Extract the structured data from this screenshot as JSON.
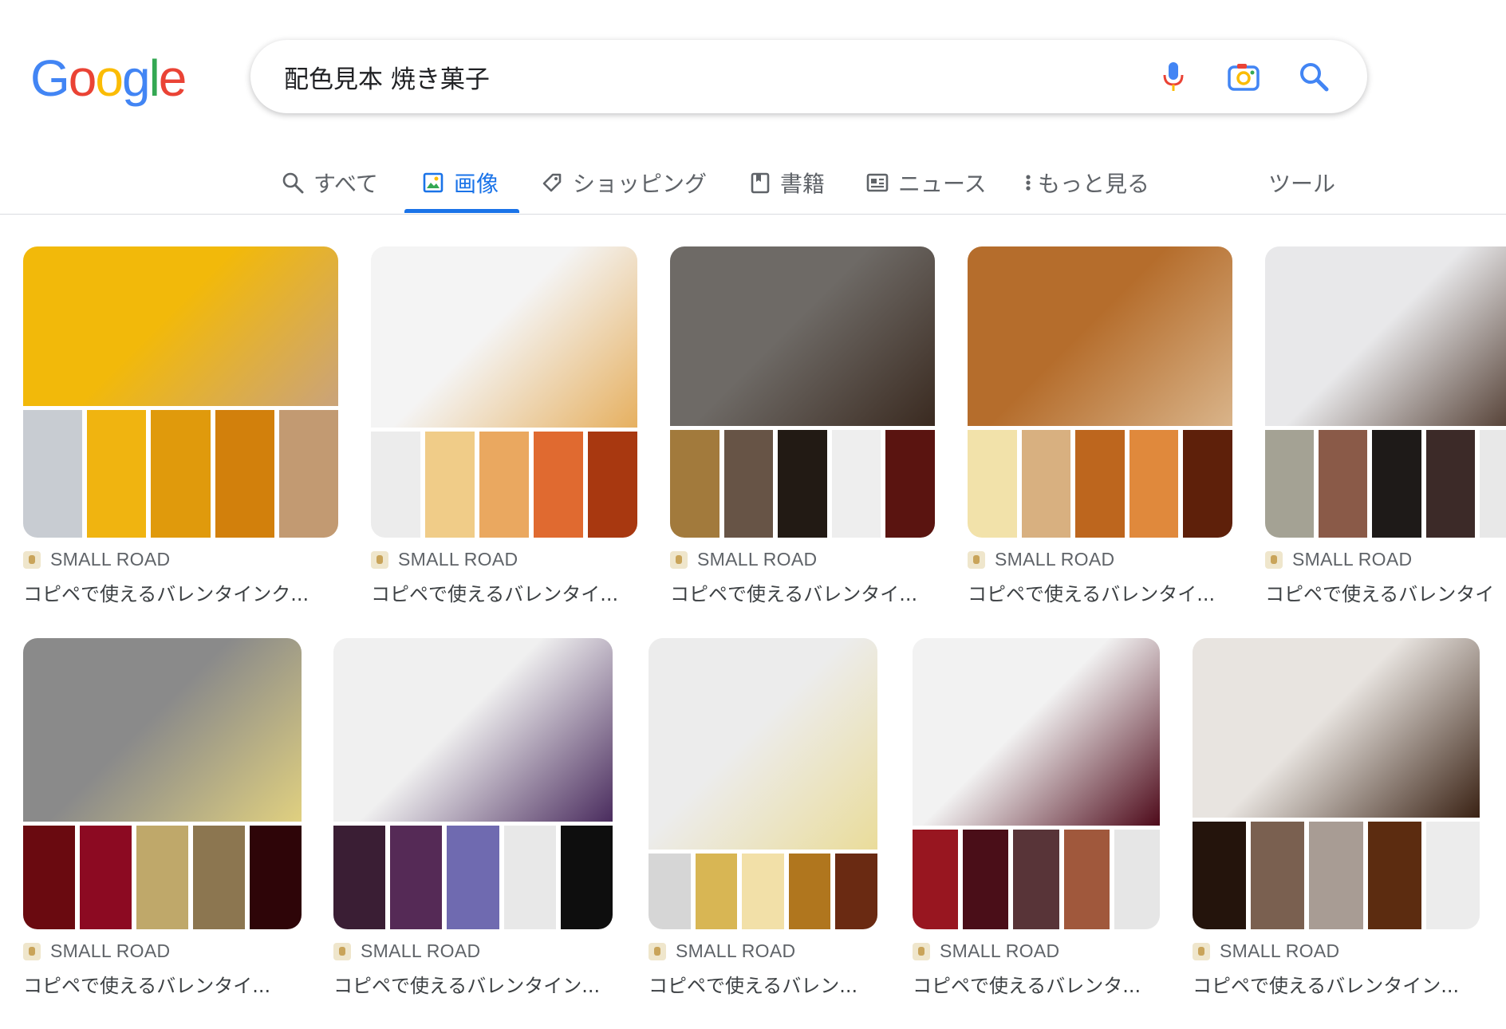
{
  "logo": {
    "text": "Google",
    "letters": [
      "G",
      "o",
      "o",
      "g",
      "l",
      "e"
    ],
    "colors": [
      "#4285f4",
      "#ea4335",
      "#fbbc05",
      "#4285f4",
      "#34a853",
      "#ea4335"
    ]
  },
  "search": {
    "query": "配色見本 焼き菓子",
    "icons": [
      "microphone-icon",
      "camera-lens-icon",
      "search-icon"
    ]
  },
  "tabs": [
    {
      "label": "すべて",
      "icon": "search-icon"
    },
    {
      "label": "画像",
      "icon": "image-icon",
      "active": true
    },
    {
      "label": "ショッピング",
      "icon": "tag-icon"
    },
    {
      "label": "書籍",
      "icon": "book-icon"
    },
    {
      "label": "ニュース",
      "icon": "news-icon"
    },
    {
      "label": "もっと見る",
      "icon": "more-vert-icon"
    },
    {
      "label": "ツール"
    }
  ],
  "results": [
    {
      "source": "SMALL ROAD",
      "title": "コピペで使えるバレンタインク...",
      "photo": [
        "#f2b90a",
        "#caa37a"
      ],
      "palette": [
        "#c8ccd2",
        "#f0b410",
        "#e09a0c",
        "#d2800c",
        "#c29a72"
      ]
    },
    {
      "source": "SMALL ROAD",
      "title": "コピペで使えるバレンタイ...",
      "photo": [
        "#f4f4f4",
        "#e6b060"
      ],
      "palette": [
        "#ececec",
        "#f0cc88",
        "#eaa860",
        "#e06a30",
        "#a83810"
      ]
    },
    {
      "source": "SMALL ROAD",
      "title": "コピペで使えるバレンタイ...",
      "photo": [
        "#6e6a66",
        "#3a2a20"
      ],
      "palette": [
        "#a27a3c",
        "#675446",
        "#221a14",
        "#eeeeee",
        "#5a1410"
      ]
    },
    {
      "source": "SMALL ROAD",
      "title": "コピペで使えるバレンタイ...",
      "photo": [
        "#b56d2c",
        "#d9b48a"
      ],
      "palette": [
        "#f2e2aa",
        "#d8b080",
        "#bd661e",
        "#e0893c",
        "#5e200a"
      ]
    },
    {
      "source": "SMALL ROAD",
      "title": "コピペで使えるバレンタイ",
      "photo": [
        "#e8e8ea",
        "#4a3428"
      ],
      "palette": [
        "#a4a294",
        "#8a5a48",
        "#1e1a18",
        "#3c2a28",
        "#e8e8e8"
      ]
    },
    {
      "source": "SMALL ROAD",
      "title": "コピペで使えるバレンタイ...",
      "photo": [
        "#8a8a8a",
        "#e0d080"
      ],
      "palette": [
        "#6a0a10",
        "#8c0a22",
        "#bfa86a",
        "#8c7650",
        "#2e0508"
      ]
    },
    {
      "source": "SMALL ROAD",
      "title": "コピペで使えるバレンタイン...",
      "photo": [
        "#f0f0f0",
        "#4a2c5e"
      ],
      "palette": [
        "#3a1e34",
        "#552a56",
        "#6f6ab0",
        "#e8e8e8",
        "#0e0e0e"
      ]
    },
    {
      "source": "SMALL ROAD",
      "title": "コピペで使えるバレン...",
      "photo": [
        "#ececec",
        "#eadc9a"
      ],
      "palette": [
        "#d6d6d6",
        "#d8b654",
        "#f2e0a8",
        "#b0761e",
        "#6a2a12"
      ]
    },
    {
      "source": "SMALL ROAD",
      "title": "コピペで使えるバレンタ...",
      "photo": [
        "#f2f2f2",
        "#4e0a1a"
      ],
      "palette": [
        "#981620",
        "#4a0e18",
        "#583438",
        "#a0583c",
        "#e6e6e6"
      ]
    },
    {
      "source": "SMALL ROAD",
      "title": "コピペで使えるバレンタイン...",
      "photo": [
        "#e8e4e0",
        "#3a2214"
      ],
      "palette": [
        "#24140c",
        "#7a6050",
        "#a89c94",
        "#5c2c10",
        "#ececec"
      ]
    }
  ]
}
